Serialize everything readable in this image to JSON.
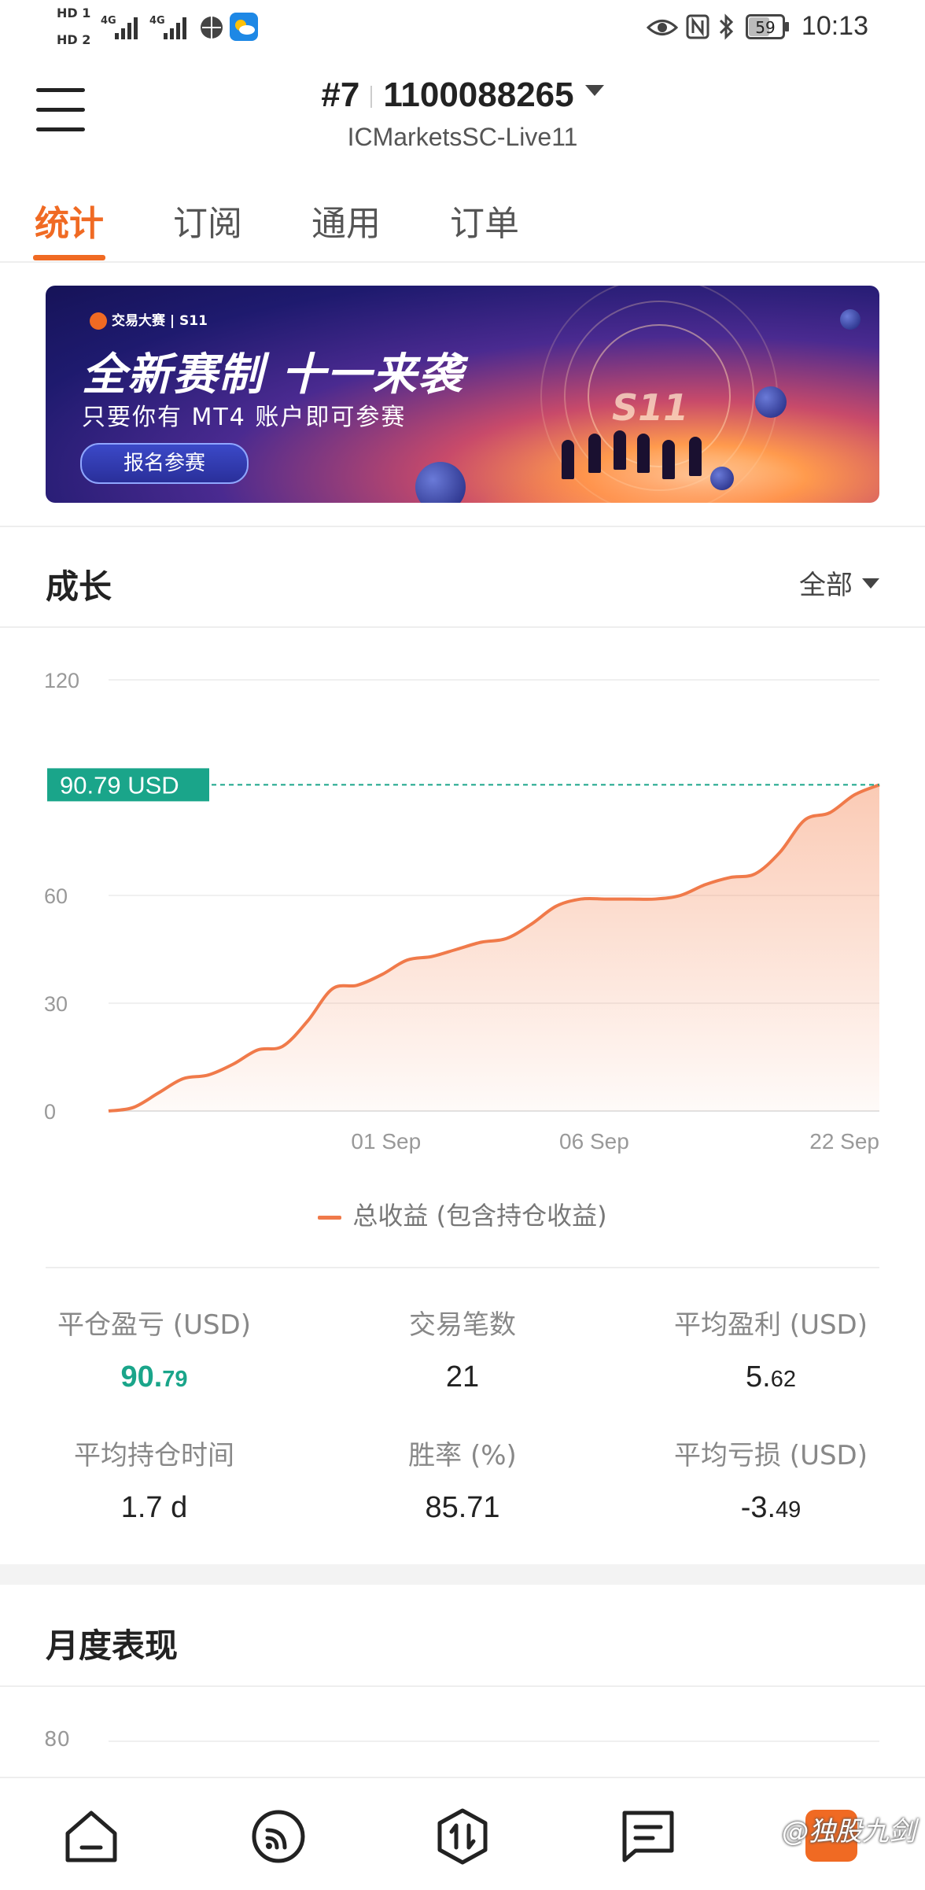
{
  "status_bar": {
    "sim1": "HD 1",
    "sim2": "HD 2",
    "net1": "4G",
    "net2": "4G",
    "battery": "59",
    "time": "10:13"
  },
  "header": {
    "rank": "#7",
    "account": "1100088265",
    "server": "ICMarketsSC-Live11"
  },
  "tabs": [
    {
      "label": "统计",
      "active": true
    },
    {
      "label": "订阅",
      "active": false
    },
    {
      "label": "通用",
      "active": false
    },
    {
      "label": "订单",
      "active": false
    }
  ],
  "banner": {
    "tag": "交易大赛 | S11",
    "headline": "全新赛制  十一来袭",
    "subtitle": "只要你有 MT4 账户即可参赛",
    "button": "报名参赛",
    "emblem": "S11"
  },
  "growth": {
    "title": "成长",
    "filter": "全部"
  },
  "chart_data": {
    "type": "area",
    "y_ticks": [
      "0",
      "30",
      "60",
      "120"
    ],
    "ylim": [
      0,
      120
    ],
    "x_ticks": [
      "01 Sep",
      "06 Sep",
      "22 Sep"
    ],
    "current_label": "90.79 USD",
    "current_value": 90.79,
    "series": [
      {
        "name": "总收益 (包含持仓收益)",
        "color": "#f07a4a",
        "values": [
          0,
          1,
          5,
          9,
          10,
          13,
          17,
          18,
          25,
          34,
          35,
          38,
          42,
          43,
          45,
          47,
          48,
          52,
          57,
          59,
          59,
          59,
          59,
          60,
          63,
          65,
          66,
          72,
          81,
          83,
          88,
          90.79
        ]
      }
    ]
  },
  "stats": [
    {
      "label": "平仓盈亏 (USD)",
      "int": "90.",
      "dec": "79",
      "green": true
    },
    {
      "label": "交易笔数",
      "int": "21",
      "dec": "",
      "green": false
    },
    {
      "label": "平均盈利 (USD)",
      "int": "5.",
      "dec": "62",
      "green": false
    },
    {
      "label": "平均持仓时间",
      "int": "1.7 d",
      "dec": "",
      "green": false
    },
    {
      "label": "胜率 (%)",
      "int": "85.71",
      "dec": "",
      "green": false
    },
    {
      "label": "平均亏损 (USD)",
      "int": "-3.",
      "dec": "49",
      "green": false
    }
  ],
  "monthly": {
    "title": "月度表现",
    "axis_top": "80"
  },
  "watermark": "@独股九剑",
  "colors": {
    "accent": "#f06a23",
    "profit_green": "#1aa58a",
    "series": "#f07a4a"
  }
}
